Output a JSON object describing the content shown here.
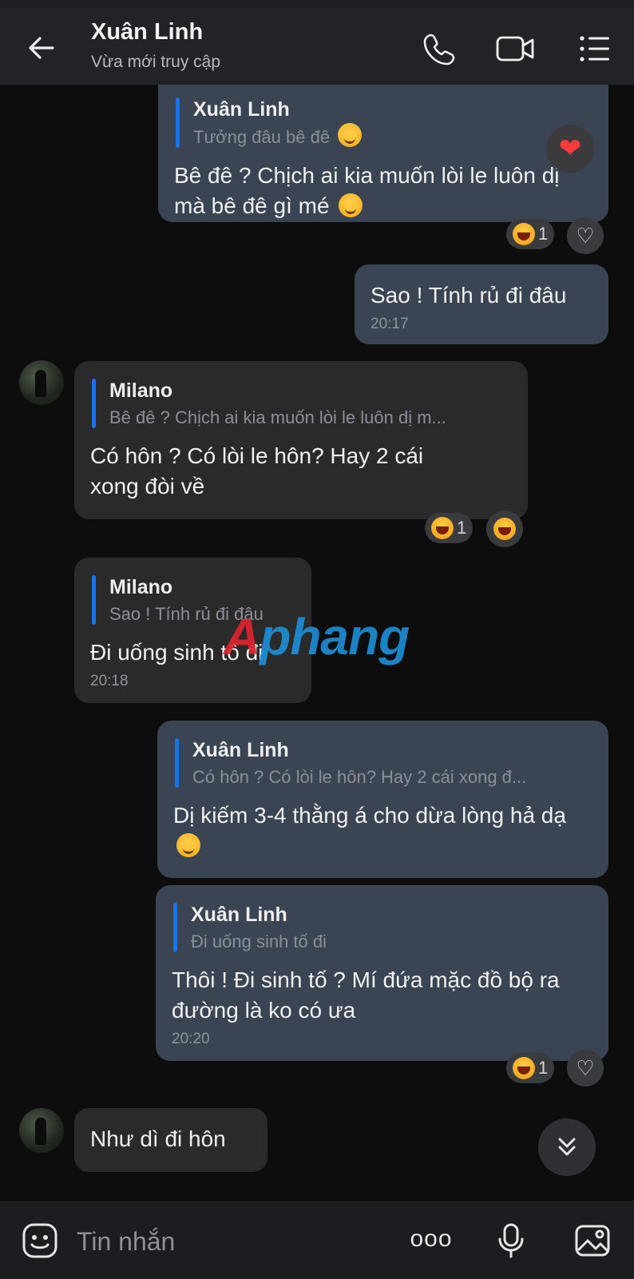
{
  "header": {
    "title": "Xuân Linh",
    "subtitle": "Vừa mới truy cập"
  },
  "messages": [
    {
      "quote_name": "Xuân Linh",
      "quote_text": "Tưởng đâu bê đê",
      "text": "Bê đê ? Chịch ai kia muốn lòi le luôn dị mà bê đê gì mé",
      "reaction_count": "1"
    },
    {
      "text": "Sao ! Tính rủ đi đâu",
      "time": "20:17"
    },
    {
      "quote_name": "Milano",
      "quote_text": "Bê đê ? Chịch ai kia muốn lòi le luôn dị m...",
      "text": "Có hôn ? Có lòi le hôn? Hay 2 cái xong đòi về",
      "reaction_count": "1"
    },
    {
      "quote_name": "Milano",
      "quote_text": "Sao ! Tính rủ đi đâu",
      "text": "Đi uống sinh tố đi",
      "time": "20:18"
    },
    {
      "quote_name": "Xuân Linh",
      "quote_text": "Có hôn ? Có lòi le hôn? Hay 2 cái xong đ...",
      "text": "Dị kiếm 3-4 thằng á cho dừa lòng hả dạ"
    },
    {
      "quote_name": "Xuân Linh",
      "quote_text": "Đi uống sinh tố đi",
      "text": "Thôi ! Đi sinh tố ? Mí đứa mặc đồ bộ ra đường là ko có ưa",
      "time": "20:20",
      "reaction_count": "1"
    },
    {
      "text": "Như dì đi hôn"
    }
  ],
  "watermark": {
    "first": "A",
    "rest": "phang"
  },
  "composer": {
    "placeholder": "Tin nhắn",
    "more_label": "ooo"
  },
  "colors": {
    "accent": "#1a73e8",
    "mine_bubble": "#3a4452",
    "their_bubble": "#2a2a2b"
  },
  "icons": [
    "back-arrow-icon",
    "phone-icon",
    "video-call-icon",
    "menu-list-icon",
    "heart-icon",
    "laugh-emoji-icon",
    "chevron-double-down-icon",
    "sticker-icon",
    "microphone-icon",
    "image-icon"
  ]
}
